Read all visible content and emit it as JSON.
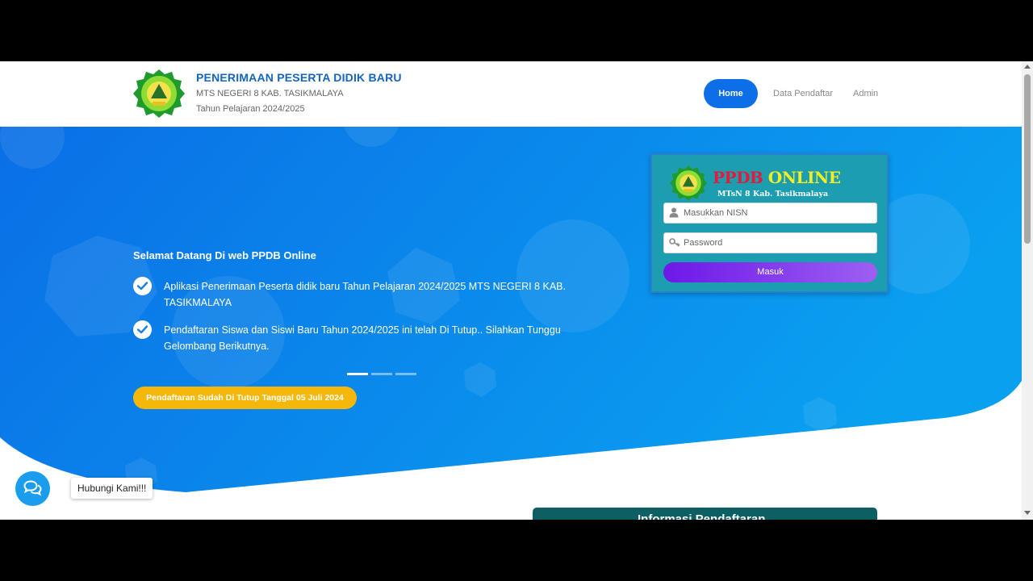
{
  "header": {
    "title": "PENERIMAAN PESERTA DIDIK BARU",
    "school": "MTS NEGERI 8 KAB. TASIKMALAYA",
    "year": "Tahun Pelajaran 2024/2025"
  },
  "nav": {
    "home": "Home",
    "data_pendaftar": "Data Pendaftar",
    "admin": "Admin"
  },
  "hero": {
    "welcome": "Selamat Datang Di web PPDB Online",
    "items": [
      "Aplikasi Penerimaan Peserta didik baru Tahun Pelajaran 2024/2025 MTS NEGERI 8 KAB. TASIKMALAYA",
      "Pendaftaran Siswa dan Siswi Baru Tahun 2024/2025 ini telah Di Tutup.. Silahkan Tunggu Gelombang Berikutnya."
    ],
    "closed_button": "Pendaftaran Sudah Di Tutup Tanggal 05 Juli 2024",
    "carousel_active_index": 0,
    "carousel_count": 3
  },
  "login": {
    "title_ppdb": "PPDB",
    "title_online": "ONLINE",
    "subtitle": "MTsN 8 Kab. Tasikmalaya",
    "nisn_placeholder": "Masukkan NISN",
    "password_placeholder": "Password",
    "submit_label": "Masuk"
  },
  "info": {
    "title": "Informasi Pendaftaran"
  },
  "chat": {
    "label": "Hubungi Kami!!!"
  },
  "colors": {
    "brand_blue": "#0d6ee8",
    "hero_start": "#0a6fe6",
    "hero_end": "#0aa0f0",
    "warning": "#f5b70a",
    "card_bg": "#1c9db0",
    "button_purple": "#7c2ff0",
    "info_teal": "#0e5f63"
  },
  "icons": {
    "check": "check-circle-icon",
    "user": "user-icon",
    "key": "key-icon",
    "chat": "chat-bubbles-icon"
  }
}
